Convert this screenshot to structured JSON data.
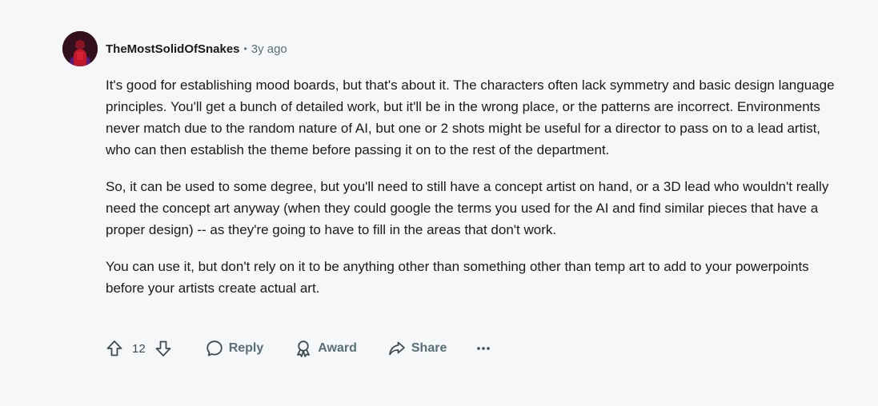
{
  "comment": {
    "author": "TheMostSolidOfSnakes",
    "separator": "•",
    "time": "3y ago",
    "paragraphs": [
      "It's good for establishing mood boards, but that's about it. The characters often lack symmetry and basic design language principles. You'll get a bunch of detailed work, but it'll be in the wrong place, or the patterns are incorrect. Environments never match due to the random nature of AI, but one or 2 shots might be useful for a director to pass on to a lead artist, who can then establish the theme before passing it on to the rest of the department.",
      "So, it can be used to some degree, but you'll need to still have a concept artist on hand, or a 3D lead who wouldn't really need the concept art anyway (when they could google the terms you used for the AI and find similar pieces that have a proper design) -- as they're going to have to fill in the areas that don't work.",
      "You can use it, but don't rely on it to be anything other than something other than temp art to add to your powerpoints before your artists create actual art."
    ]
  },
  "actions": {
    "vote_count": "12",
    "reply_label": "Reply",
    "award_label": "Award",
    "share_label": "Share",
    "more_icon": "ellipsis-icon"
  },
  "icons": {
    "upvote": "upvote-arrow-icon",
    "downvote": "downvote-arrow-icon",
    "reply": "speech-bubble-icon",
    "award": "award-ribbon-icon",
    "share": "share-arrow-icon"
  },
  "colors": {
    "background": "#f6f7f8",
    "text": "#1a1a1b",
    "muted": "#576f76"
  }
}
